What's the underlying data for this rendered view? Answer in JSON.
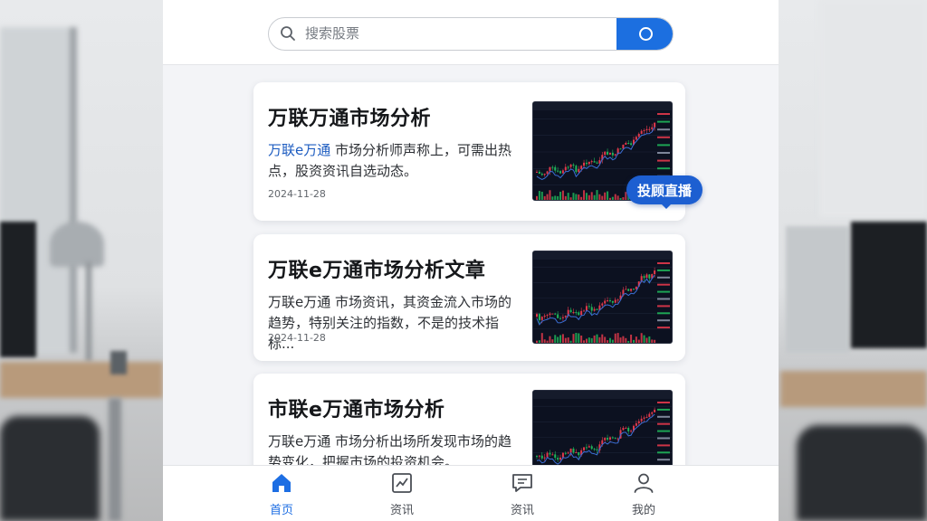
{
  "search": {
    "placeholder": "搜索股票"
  },
  "articles": [
    {
      "title": "万联万通市场分析",
      "excerpt_highlight": "万联e万通",
      "excerpt_rest": "市场分析师声称上，可需出热点，股资资讯自选动态。",
      "date": "2024-11-28"
    },
    {
      "title": "万联e万通市场分析文章",
      "excerpt_highlight": "",
      "excerpt_rest": "万联e万通 市场资讯，其资金流入市场的趋势，特别关注的指数，不是的技术指标...",
      "date": "2024-11-28"
    },
    {
      "title": "市联e万通市场分析",
      "excerpt_highlight": "",
      "excerpt_rest": "万联e万通 市场分析出场所发现市场的趋势变化，把握市场的投资机会。",
      "date": ""
    }
  ],
  "live_badge": "投顾直播",
  "tabs": [
    {
      "label": "首页",
      "icon": "home-icon",
      "active": true
    },
    {
      "label": "资讯",
      "icon": "chart-icon",
      "active": false
    },
    {
      "label": "资讯",
      "icon": "message-icon",
      "active": false
    },
    {
      "label": "我的",
      "icon": "user-icon",
      "active": false
    }
  ],
  "colors": {
    "accent": "#1c6fe0",
    "chart_up": "#e2394b",
    "chart_down": "#1fb55a",
    "chart_line": "#3b6fd6"
  }
}
